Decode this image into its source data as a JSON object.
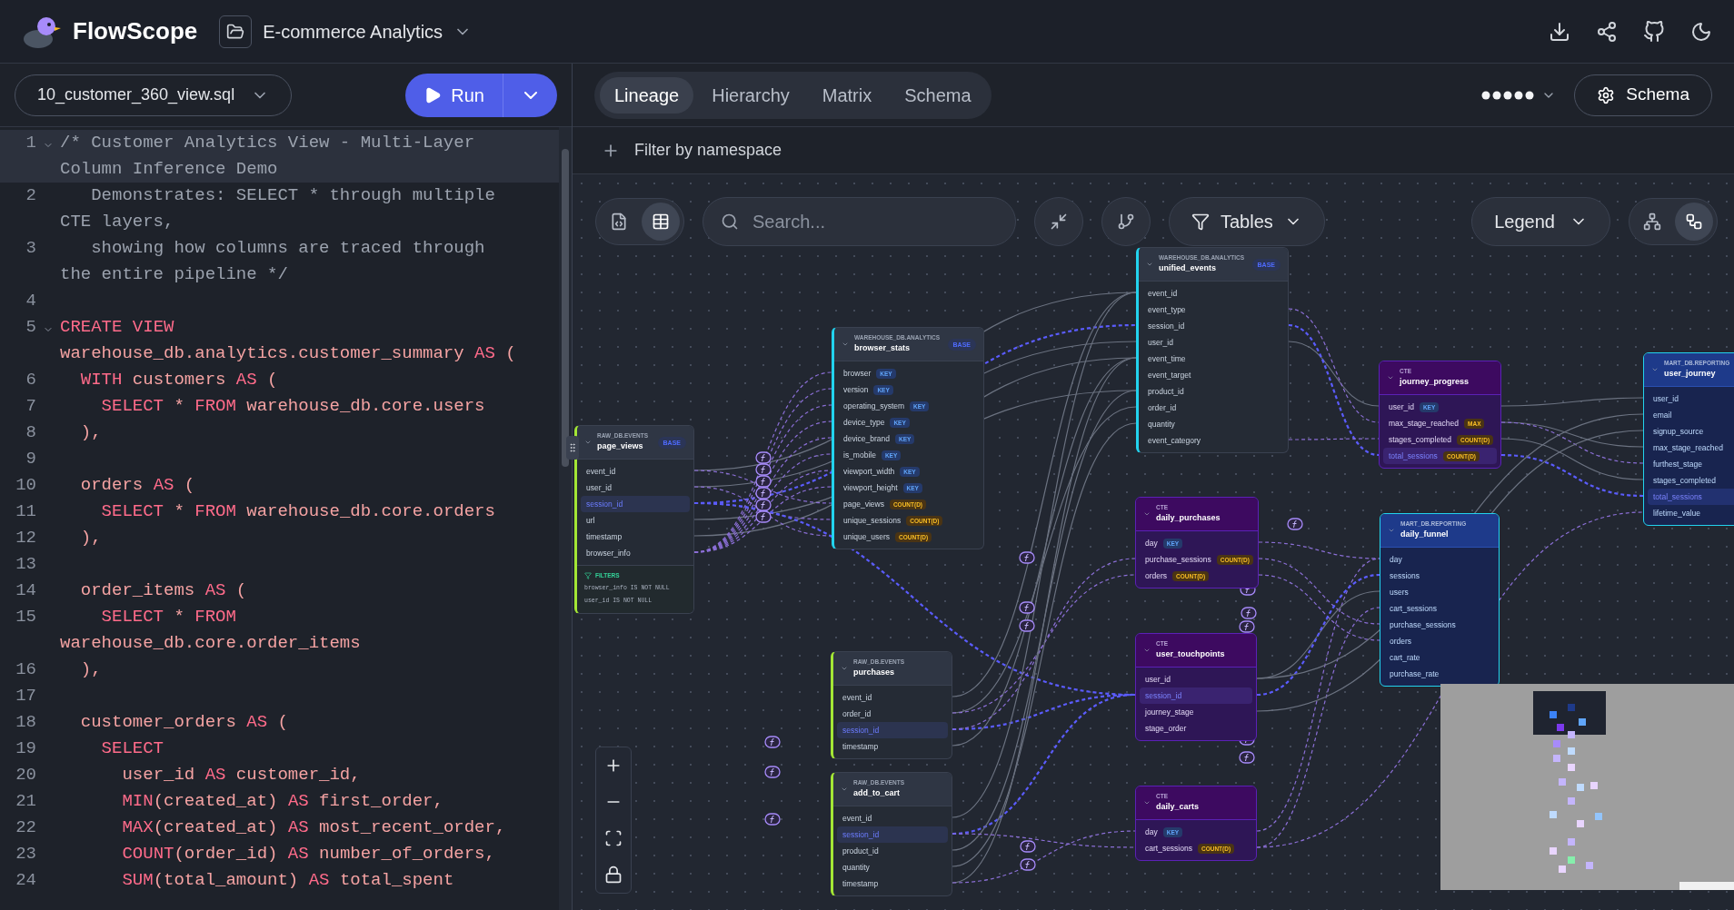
{
  "app": {
    "name": "FlowScope"
  },
  "project": {
    "name": "E-commerce Analytics"
  },
  "editor": {
    "file": "10_customer_360_view.sql",
    "run_label": "Run",
    "lines": [
      {
        "number": "1",
        "text": "/* Customer Analytics View - Multi-Layer Column Inference Demo",
        "kind": "comment",
        "foldable": true,
        "current": true
      },
      {
        "number": "2",
        "text": "   Demonstrates: SELECT * through multiple CTE layers,",
        "kind": "comment",
        "foldable": false,
        "current": false
      },
      {
        "number": "3",
        "text": "   showing how columns are traced through the entire pipeline */",
        "kind": "comment",
        "foldable": false,
        "current": false
      },
      {
        "number": "4",
        "foldable": false,
        "current": false
      },
      {
        "number": "5",
        "text": "CREATE VIEW warehouse_db.analytics.customer_summary AS (",
        "kind": "code",
        "foldable": true,
        "current": false
      },
      {
        "number": "6",
        "text": "  WITH customers AS (",
        "kind": "code",
        "foldable": false,
        "current": false
      },
      {
        "number": "7",
        "text": "    SELECT * FROM warehouse_db.core.users",
        "kind": "code",
        "foldable": false,
        "current": false
      },
      {
        "number": "8",
        "text": "  ),",
        "kind": "code",
        "foldable": false,
        "current": false
      },
      {
        "number": "9",
        "foldable": false,
        "current": false
      },
      {
        "number": "10",
        "text": "  orders AS (",
        "kind": "code",
        "foldable": false,
        "current": false
      },
      {
        "number": "11",
        "text": "    SELECT * FROM warehouse_db.core.orders",
        "kind": "code",
        "foldable": false,
        "current": false
      },
      {
        "number": "12",
        "text": "  ),",
        "kind": "code",
        "foldable": false,
        "current": false
      },
      {
        "number": "13",
        "foldable": false,
        "current": false
      },
      {
        "number": "14",
        "text": "  order_items AS (",
        "kind": "code",
        "foldable": false,
        "current": false
      },
      {
        "number": "15",
        "text": "    SELECT * FROM warehouse_db.core.order_items",
        "kind": "code",
        "foldable": false,
        "current": false
      },
      {
        "number": "16",
        "text": "  ),",
        "kind": "code",
        "foldable": false,
        "current": false
      },
      {
        "number": "17",
        "foldable": false,
        "current": false
      },
      {
        "number": "18",
        "text": "  customer_orders AS (",
        "kind": "code",
        "foldable": false,
        "current": false
      },
      {
        "number": "19",
        "text": "    SELECT",
        "kind": "code",
        "foldable": false,
        "current": false
      },
      {
        "number": "20",
        "text": "      user_id AS customer_id,",
        "kind": "code",
        "foldable": false,
        "current": false
      },
      {
        "number": "21",
        "text": "      MIN(created_at) AS first_order,",
        "kind": "code",
        "foldable": false,
        "current": false
      },
      {
        "number": "22",
        "text": "      MAX(created_at) AS most_recent_order,",
        "kind": "code",
        "foldable": false,
        "current": false
      },
      {
        "number": "23",
        "text": "      COUNT(order_id) AS number_of_orders,",
        "kind": "code",
        "foldable": false,
        "current": false
      },
      {
        "number": "24",
        "text": "      SUM(total_amount) AS total_spent",
        "kind": "code",
        "foldable": false,
        "current": false
      }
    ]
  },
  "view_tabs": [
    {
      "label": "Lineage",
      "selected": true
    },
    {
      "label": "Hierarchy",
      "selected": false
    },
    {
      "label": "Matrix",
      "selected": false
    },
    {
      "label": "Schema",
      "selected": false
    }
  ],
  "schema_button": {
    "label": "Schema"
  },
  "filter": {
    "label": "Filter by namespace"
  },
  "canvas_toolbar": {
    "mode_buttons": [
      {
        "kind": "code",
        "selected": false
      },
      {
        "kind": "table",
        "selected": true
      }
    ],
    "search": {
      "placeholder": "Search..."
    },
    "tables_dropdown": "Tables",
    "legend_dropdown": "Legend",
    "layout_buttons": [
      {
        "kind": "tree",
        "selected": false
      },
      {
        "kind": "graph",
        "selected": true
      }
    ]
  },
  "nodes": [
    {
      "kind": "raw",
      "schema": "RAW_DB.EVENTS",
      "name": "page_views",
      "badge": "BASE",
      "columns": [
        {
          "name": "event_id",
          "selected": false
        },
        {
          "name": "user_id",
          "selected": false
        },
        {
          "name": "session_id",
          "selected": true
        },
        {
          "name": "url",
          "selected": false
        },
        {
          "name": "timestamp",
          "selected": false
        },
        {
          "name": "browser_info",
          "selected": false
        }
      ],
      "filters": {
        "label": "FILTERS",
        "items": [
          "browser_info IS NOT NULL",
          "user_id IS NOT NULL"
        ]
      }
    },
    {
      "kind": "warehouse",
      "schema": "WAREHOUSE_DB.ANALYTICS",
      "name": "browser_stats",
      "badge": "BASE",
      "columns": [
        {
          "name": "browser",
          "selected": false,
          "tag": {
            "label": "KEY",
            "kind": "key"
          }
        },
        {
          "name": "version",
          "selected": false,
          "tag": {
            "label": "KEY",
            "kind": "key"
          }
        },
        {
          "name": "operating_system",
          "selected": false,
          "tag": {
            "label": "KEY",
            "kind": "key"
          }
        },
        {
          "name": "device_type",
          "selected": false,
          "tag": {
            "label": "KEY",
            "kind": "key"
          }
        },
        {
          "name": "device_brand",
          "selected": false,
          "tag": {
            "label": "KEY",
            "kind": "key"
          }
        },
        {
          "name": "is_mobile",
          "selected": false,
          "tag": {
            "label": "KEY",
            "kind": "key"
          }
        },
        {
          "name": "viewport_width",
          "selected": false,
          "tag": {
            "label": "KEY",
            "kind": "key"
          }
        },
        {
          "name": "viewport_height",
          "selected": false,
          "tag": {
            "label": "KEY",
            "kind": "key"
          }
        },
        {
          "name": "page_views",
          "selected": false,
          "tag": {
            "label": "COUNT(D)",
            "kind": "aggregate"
          }
        },
        {
          "name": "unique_sessions",
          "selected": false,
          "tag": {
            "label": "COUNT(D)",
            "kind": "aggregate"
          }
        },
        {
          "name": "unique_users",
          "selected": false,
          "tag": {
            "label": "COUNT(D)",
            "kind": "aggregate"
          }
        }
      ]
    },
    {
      "kind": "warehouse",
      "schema": "WAREHOUSE_DB.ANALYTICS",
      "name": "unified_events",
      "badge": "BASE",
      "columns": [
        {
          "name": "event_id",
          "selected": false
        },
        {
          "name": "event_type",
          "selected": false
        },
        {
          "name": "session_id",
          "selected": false
        },
        {
          "name": "user_id",
          "selected": false
        },
        {
          "name": "event_time",
          "selected": false
        },
        {
          "name": "event_target",
          "selected": false
        },
        {
          "name": "product_id",
          "selected": false
        },
        {
          "name": "order_id",
          "selected": false
        },
        {
          "name": "quantity",
          "selected": false
        },
        {
          "name": "event_category",
          "selected": false
        }
      ]
    },
    {
      "kind": "cte",
      "schema": "CTE",
      "name": "journey_progress",
      "columns": [
        {
          "name": "user_id",
          "selected": false,
          "tag": {
            "label": "KEY",
            "kind": "key"
          }
        },
        {
          "name": "max_stage_reached",
          "selected": false,
          "tag": {
            "label": "MAX",
            "kind": "aggregate"
          }
        },
        {
          "name": "stages_completed",
          "selected": false,
          "tag": {
            "label": "COUNT(D)",
            "kind": "aggregate"
          }
        },
        {
          "name": "total_sessions",
          "selected": true,
          "tag": {
            "label": "COUNT(D)",
            "kind": "aggregate"
          }
        }
      ]
    },
    {
      "kind": "mart",
      "schema": "MART_DB.REPORTING",
      "name": "user_journey",
      "columns": [
        {
          "name": "user_id",
          "selected": false
        },
        {
          "name": "email",
          "selected": false
        },
        {
          "name": "signup_source",
          "selected": false
        },
        {
          "name": "max_stage_reached",
          "selected": false
        },
        {
          "name": "furthest_stage",
          "selected": false
        },
        {
          "name": "stages_completed",
          "selected": false
        },
        {
          "name": "total_sessions",
          "selected": true
        },
        {
          "name": "lifetime_value",
          "selected": false
        }
      ]
    },
    {
      "kind": "cte",
      "schema": "CTE",
      "name": "daily_purchases",
      "columns": [
        {
          "name": "day",
          "selected": false,
          "tag": {
            "label": "KEY",
            "kind": "key"
          }
        },
        {
          "name": "purchase_sessions",
          "selected": false,
          "tag": {
            "label": "COUNT(D)",
            "kind": "aggregate"
          }
        },
        {
          "name": "orders",
          "selected": false,
          "tag": {
            "label": "COUNT(D)",
            "kind": "aggregate"
          }
        }
      ]
    },
    {
      "kind": "mart",
      "schema": "MART_DB.REPORTING",
      "name": "daily_funnel",
      "columns": [
        {
          "name": "day",
          "selected": false
        },
        {
          "name": "sessions",
          "selected": false
        },
        {
          "name": "users",
          "selected": false
        },
        {
          "name": "cart_sessions",
          "selected": false
        },
        {
          "name": "purchase_sessions",
          "selected": false
        },
        {
          "name": "orders",
          "selected": false
        },
        {
          "name": "cart_rate",
          "selected": false
        },
        {
          "name": "purchase_rate",
          "selected": false
        }
      ]
    },
    {
      "kind": "raw",
      "schema": "RAW_DB.EVENTS",
      "name": "purchases",
      "columns": [
        {
          "name": "event_id",
          "selected": false
        },
        {
          "name": "order_id",
          "selected": false
        },
        {
          "name": "session_id",
          "selected": true
        },
        {
          "name": "timestamp",
          "selected": false
        }
      ]
    },
    {
      "kind": "raw",
      "schema": "RAW_DB.EVENTS",
      "name": "add_to_cart",
      "columns": [
        {
          "name": "event_id",
          "selected": false
        },
        {
          "name": "session_id",
          "selected": true
        },
        {
          "name": "product_id",
          "selected": false
        },
        {
          "name": "quantity",
          "selected": false
        },
        {
          "name": "timestamp",
          "selected": false
        }
      ]
    },
    {
      "kind": "cte",
      "schema": "CTE",
      "name": "user_touchpoints",
      "columns": [
        {
          "name": "user_id",
          "selected": false
        },
        {
          "name": "session_id",
          "selected": true
        },
        {
          "name": "journey_stage",
          "selected": false
        },
        {
          "name": "stage_order",
          "selected": false
        }
      ]
    },
    {
      "kind": "cte",
      "schema": "CTE",
      "name": "daily_carts",
      "columns": [
        {
          "name": "day",
          "selected": false,
          "tag": {
            "label": "KEY",
            "kind": "key"
          }
        },
        {
          "name": "cart_sessions",
          "selected": false,
          "tag": {
            "label": "COUNT(D)",
            "kind": "aggregate"
          }
        }
      ]
    }
  ]
}
